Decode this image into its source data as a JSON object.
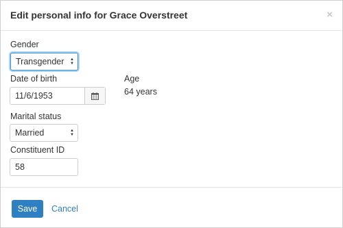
{
  "modal": {
    "title": "Edit personal info for Grace Overstreet",
    "close_symbol": "×"
  },
  "fields": {
    "gender": {
      "label": "Gender",
      "value": "Transgender"
    },
    "date_of_birth": {
      "label": "Date of birth",
      "value": "11/6/1953",
      "icon": "calendar-icon"
    },
    "age": {
      "label": "Age",
      "value": "64 years"
    },
    "marital_status": {
      "label": "Marital status",
      "value": "Married"
    },
    "constituent_id": {
      "label": "Constituent ID",
      "value": "58"
    }
  },
  "footer": {
    "save_label": "Save",
    "cancel_label": "Cancel"
  },
  "colors": {
    "primary": "#2f80c3",
    "focus_ring": "#66afe9"
  }
}
